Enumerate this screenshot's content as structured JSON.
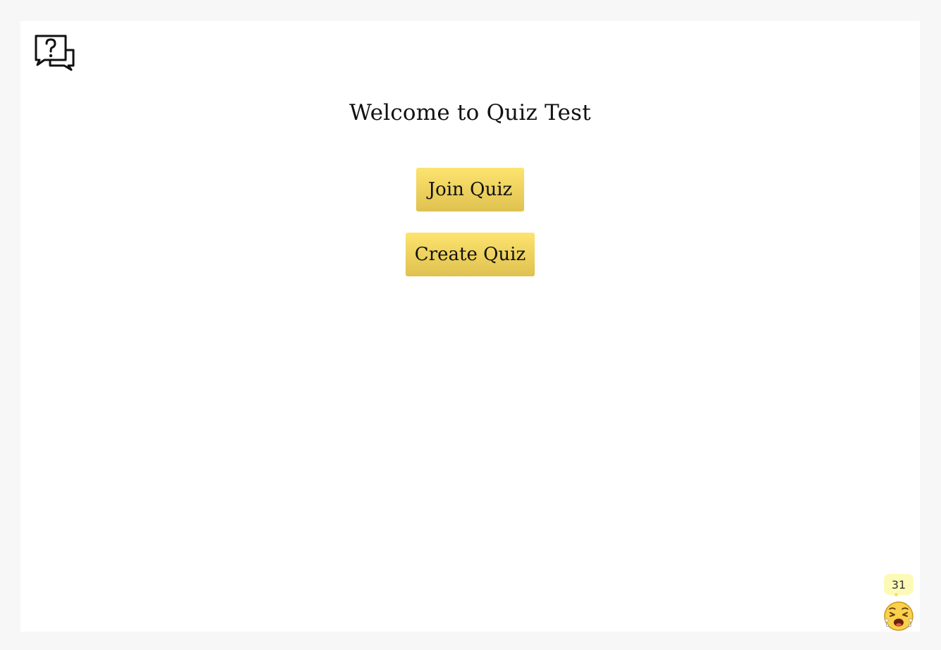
{
  "header": {
    "logo_icon": "question-chat-icon"
  },
  "main": {
    "title": "Welcome to Quiz Test",
    "join_label": "Join Quiz",
    "create_label": "Create Quiz"
  },
  "widget": {
    "count": "31",
    "emoji_icon": "crying-face-icon"
  },
  "colors": {
    "button_top": "#fde36f",
    "button_bottom": "#dfc14f",
    "background": "#f7f7f7",
    "counter_bg": "#fdfab8"
  }
}
